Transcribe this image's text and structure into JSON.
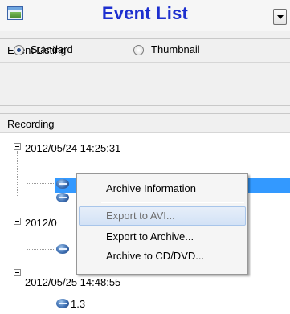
{
  "header": {
    "title": "Event List",
    "title_color": "#1d2fcf",
    "app_icon": "picture-icon",
    "dropdown_icon": "chevron-down-icon"
  },
  "event_listing": {
    "label": "Event Listing",
    "options": [
      {
        "label": "Standard",
        "checked": true
      },
      {
        "label": "Thumbnail",
        "checked": false
      }
    ]
  },
  "recording": {
    "label": "Recording",
    "groups": [
      {
        "date": "2012/05/24 14:25:31",
        "items": [
          "",
          ""
        ]
      },
      {
        "date": "2012/0",
        "items": [
          ""
        ]
      },
      {
        "date": "2012/05/25 14:48:55",
        "items": [
          "1.3"
        ]
      }
    ],
    "selection_color": "#3399ff",
    "camera_icon": "camera-icon"
  },
  "context_menu": {
    "items": [
      {
        "label": "Archive Information",
        "state": "normal"
      },
      {
        "label": "Export to AVI...",
        "state": "hover-disabled"
      },
      {
        "label": "Export to Archive...",
        "state": "normal"
      },
      {
        "label": "Archive to CD/DVD...",
        "state": "normal"
      }
    ]
  }
}
